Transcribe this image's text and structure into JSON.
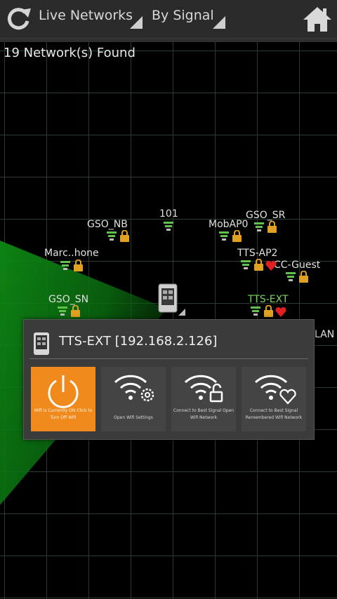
{
  "topbar": {
    "view_dropdown": "Live Networks",
    "sort_dropdown": "By Signal"
  },
  "status": {
    "found": "19 Network(s) Found"
  },
  "networks": [
    {
      "name": "GSO_NB",
      "secured": true
    },
    {
      "name": "101",
      "secured": false
    },
    {
      "name": "MobAP0",
      "secured": true
    },
    {
      "name": "GSO_SR",
      "secured": true
    },
    {
      "name": "Marc..hone",
      "secured": true
    },
    {
      "name": "TTS-AP2",
      "secured": true,
      "remembered": true
    },
    {
      "name": "CC-Guest",
      "secured": true
    },
    {
      "name": "GSO_SN",
      "secured": true
    },
    {
      "name": "TTS-EXT",
      "secured": true,
      "remembered": true,
      "selected": true
    },
    {
      "name": "LAN"
    }
  ],
  "popup": {
    "title": "TTS-EXT [192.168.2.126]",
    "actions": [
      {
        "label": "Wifi is Currently ON Click to Turn Off Wifi",
        "active": true,
        "icon": "power-icon"
      },
      {
        "label": "Open Wifi Settings",
        "icon": "wifi-settings-icon"
      },
      {
        "label": "Connect to Best Signal Open Wifi Network",
        "icon": "wifi-unlocked-icon"
      },
      {
        "label": "Connect to Best Signal Remembered Wifi Network",
        "icon": "wifi-heart-icon"
      }
    ]
  },
  "colors": {
    "accent": "#f08a1c",
    "selected_network": "#78d35a",
    "sweep": "#0c7a12",
    "remembered_heart": "#e02020",
    "lock": "#e0a020",
    "signal": "#5fc24a"
  }
}
